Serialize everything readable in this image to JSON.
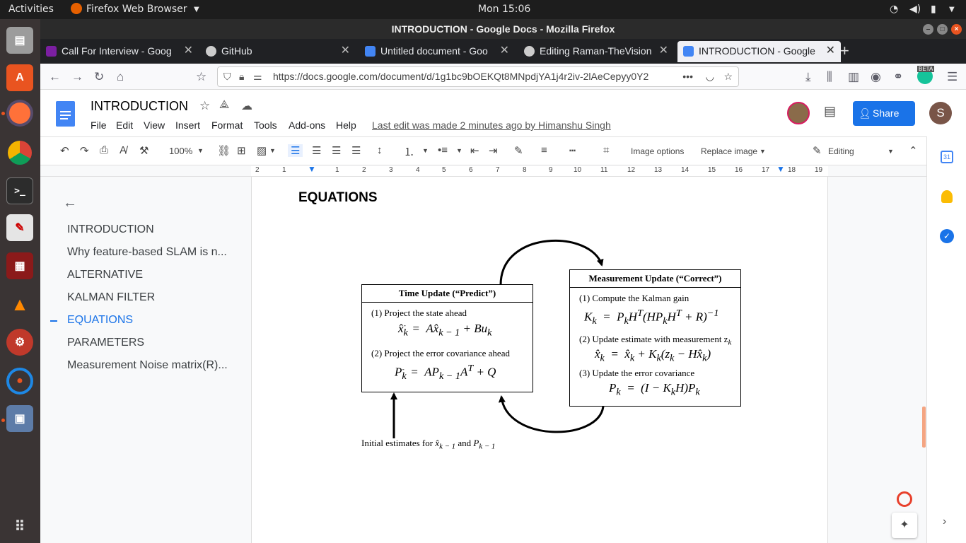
{
  "system_bar": {
    "activities": "Activities",
    "app_name": "Firefox Web Browser",
    "clock": "Mon 15:06"
  },
  "window": {
    "title": "INTRODUCTION - Google Docs - Mozilla Firefox"
  },
  "tabs": [
    {
      "label": "Call For Interview - Goog",
      "active": false
    },
    {
      "label": "GitHub",
      "active": false
    },
    {
      "label": "Untitled document - Goo",
      "active": false
    },
    {
      "label": "Editing Raman-TheVision",
      "active": false
    },
    {
      "label": "INTRODUCTION - Google",
      "active": true
    }
  ],
  "address_bar": {
    "url": "https://docs.google.com/document/d/1g1bc9bOEKQt8MNpdjYA1j4r2iv-2lAeCepyy0Y2",
    "beta_badge": "BETA"
  },
  "docs_header": {
    "doc_title": "INTRODUCTION",
    "menus": [
      "File",
      "Edit",
      "View",
      "Insert",
      "Format",
      "Tools",
      "Add-ons",
      "Help"
    ],
    "last_edit": "Last edit was made 2 minutes ago by Himanshu Singh",
    "share_label": "Share",
    "account_initial": "S"
  },
  "toolbar": {
    "zoom": "100%",
    "image_options": "Image options",
    "replace_image": "Replace image",
    "mode": "Editing"
  },
  "ruler": {
    "ticks": [
      "2",
      "1",
      "1",
      "1",
      "2",
      "3",
      "4",
      "5",
      "6",
      "7",
      "8",
      "9",
      "10",
      "11",
      "12",
      "13",
      "14",
      "15",
      "16",
      "17",
      "18",
      "19"
    ]
  },
  "outline": {
    "items": [
      {
        "label": "INTRODUCTION",
        "active": false
      },
      {
        "label": "Why feature-based SLAM is n...",
        "active": false
      },
      {
        "label": "ALTERNATIVE",
        "active": false
      },
      {
        "label": "KALMAN FILTER",
        "active": false
      },
      {
        "label": "EQUATIONS",
        "active": true
      },
      {
        "label": "PARAMETERS",
        "active": false
      },
      {
        "label": "Measurement Noise matrix(R)...",
        "active": false
      }
    ]
  },
  "document": {
    "heading": "EQUATIONS",
    "diagram": {
      "time_update": {
        "title": "Time Update (“Predict”)",
        "step1": "(1) Project the state ahead",
        "step2": "(2) Project the error covariance ahead"
      },
      "measurement_update": {
        "title": "Measurement Update (“Correct”)",
        "step1": "(1) Compute the Kalman gain",
        "step2": "(2) Update estimate with measurement z",
        "step3": "(3) Update the error covariance"
      },
      "initial": "Initial estimates for"
    }
  },
  "side_panel": {
    "calendar_day": "31"
  },
  "colors": {
    "accent": "#1a73e8",
    "share_bg": "#1a73e8",
    "dock_bg": "#3a3434",
    "topbar_bg": "#1d1d1d"
  }
}
